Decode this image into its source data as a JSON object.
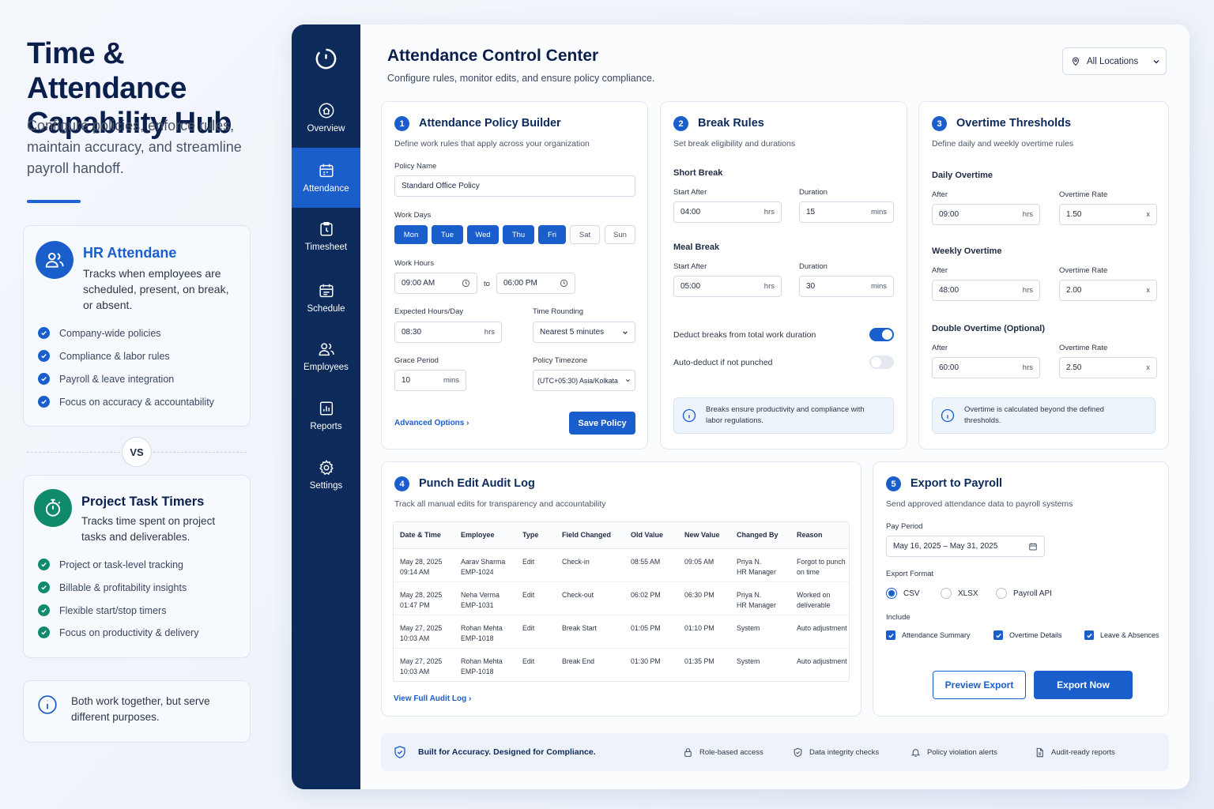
{
  "hero": {
    "title": "Time & Attendance Capability Hub",
    "subtitle": "Configure policies, enforce rules, maintain accuracy, and streamline payroll handoff."
  },
  "hr_card": {
    "title": "HR Attendane",
    "desc": "Tracks when employees are scheduled, present, on break, or absent.",
    "features": [
      "Company-wide policies",
      "Compliance & labor rules",
      "Payroll & leave integration",
      "Focus on accuracy & accountability"
    ]
  },
  "vs": "VS",
  "project_card": {
    "title": "Project Task Timers",
    "desc": "Tracks time spent on project tasks and deliverables.",
    "features": [
      "Project or task-level tracking",
      "Billable & profitability insights",
      "Flexible start/stop timers",
      "Focus on productivity & delivery"
    ]
  },
  "note": "Both work together, but serve different purposes.",
  "sidebar": {
    "items": [
      "Overview",
      "Attendance",
      "Timesheet",
      "Schedule",
      "Employees",
      "Reports",
      "Settings"
    ],
    "active": "Attendance"
  },
  "header": {
    "title": "Attendance Control Center",
    "subtitle": "Configure rules, monitor edits, and ensure policy compliance.",
    "location": "All Locations"
  },
  "policy": {
    "num": "1",
    "title": "Attendance Policy Builder",
    "subtitle": "Define work rules that apply across your organization",
    "name_label": "Policy Name",
    "name_value": "Standard Office Policy",
    "days_label": "Work Days",
    "days": [
      "Mon",
      "Tue",
      "Wed",
      "Thu",
      "Fri",
      "Sat",
      "Sun"
    ],
    "hours_label": "Work Hours",
    "start": "09:00 AM",
    "to": "to",
    "end": "06:00 PM",
    "expected_label": "Expected Hours/Day",
    "expected_value": "08:30",
    "expected_unit": "hrs",
    "rounding_label": "Time Rounding",
    "rounding_value": "Nearest 5 minutes",
    "grace_label": "Grace Period",
    "grace_value": "10",
    "grace_unit": "mins",
    "tz_label": "Policy Timezone",
    "tz_value": "(UTC+05:30) Asia/Kolkata",
    "advanced": "Advanced Options",
    "save": "Save Policy"
  },
  "breaks": {
    "num": "2",
    "title": "Break Rules",
    "subtitle": "Set break eligibility and durations",
    "short": "Short Break",
    "meal": "Meal Break",
    "start_label": "Start After",
    "duration_label": "Duration",
    "short_start": "04:00",
    "short_dur": "15",
    "meal_start": "05:00",
    "meal_dur": "30",
    "hrs": "hrs",
    "mins": "mins",
    "deduct": "Deduct breaks from total work duration",
    "auto": "Auto-deduct if not punched",
    "info": "Breaks ensure productivity and compliance with labor regulations."
  },
  "overtime": {
    "num": "3",
    "title": "Overtime Thresholds",
    "subtitle": "Define daily and weekly overtime rules",
    "daily": "Daily Overtime",
    "weekly": "Weekly Overtime",
    "double": "Double Overtime (Optional)",
    "after": "After",
    "rate": "Overtime Rate",
    "daily_after": "09:00",
    "daily_rate": "1.50",
    "weekly_after": "48:00",
    "weekly_rate": "2.00",
    "double_after": "60:00",
    "double_rate": "2.50",
    "hrs": "hrs",
    "x": "x",
    "info": "Overtime is calculated beyond the defined thresholds."
  },
  "audit": {
    "num": "4",
    "title": "Punch Edit Audit Log",
    "subtitle": "Track all manual edits for transparency and accountability",
    "columns": [
      "Date & Time",
      "Employee",
      "Type",
      "Field Changed",
      "Old Value",
      "New Value",
      "Changed By",
      "Reason"
    ],
    "rows": [
      [
        "May 28, 2025\n09:14 AM",
        "Aarav Sharma\nEMP-1024",
        "Edit",
        "Check-in",
        "08:55 AM",
        "09:05 AM",
        "Priya N.\nHR Manager",
        "Forgot to punch\non time"
      ],
      [
        "May 28, 2025\n01:47 PM",
        "Neha Verma\nEMP-1031",
        "Edit",
        "Check-out",
        "06:02 PM",
        "06:30 PM",
        "Priya N.\nHR Manager",
        "Worked on\ndeliverable"
      ],
      [
        "May 27, 2025\n10:03 AM",
        "Rohan Mehta\nEMP-1018",
        "Edit",
        "Break Start",
        "01:05 PM",
        "01:10 PM",
        "System",
        "Auto adjustment"
      ],
      [
        "May 27, 2025\n10:03 AM",
        "Rohan Mehta\nEMP-1018",
        "Edit",
        "Break End",
        "01:30 PM",
        "01:35 PM",
        "System",
        "Auto adjustment"
      ]
    ],
    "view_all": "View Full Audit Log"
  },
  "export": {
    "num": "5",
    "title": "Export to Payroll",
    "subtitle": "Send approved attendance data to payroll systems",
    "period_label": "Pay Period",
    "period": "May 16, 2025 – May 31, 2025",
    "format_label": "Export Format",
    "formats": [
      "CSV",
      "XLSX",
      "Payroll API"
    ],
    "include_label": "Include",
    "includes": [
      "Attendance Summary",
      "Overtime Details",
      "Leave & Absences"
    ],
    "preview": "Preview Export",
    "export": "Export Now"
  },
  "footer": {
    "title": "Built for Accuracy. Designed for Compliance.",
    "items": [
      "Role-based access",
      "Data integrity checks",
      "Policy violation alerts",
      "Audit-ready reports"
    ]
  },
  "colors": {
    "primary": "#1a5ecc",
    "navy": "#0c2a5a",
    "green": "#0f8a6a"
  }
}
